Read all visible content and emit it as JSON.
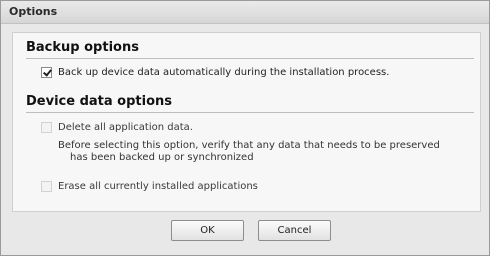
{
  "window": {
    "title": "Options"
  },
  "backup": {
    "heading": "Backup options",
    "auto_backup": {
      "label": "Back up device data automatically during the installation process.",
      "checked": true
    }
  },
  "device_data": {
    "heading": "Device data options",
    "delete_all": {
      "label": "Delete all application data.",
      "checked": false,
      "description_line1": "Before selecting this option, verify that any data that needs to be preserved",
      "description_line2": "has been backed up or synchronized"
    },
    "erase_apps": {
      "label": "Erase all currently installed applications",
      "checked": false
    }
  },
  "buttons": {
    "ok": "OK",
    "cancel": "Cancel"
  }
}
